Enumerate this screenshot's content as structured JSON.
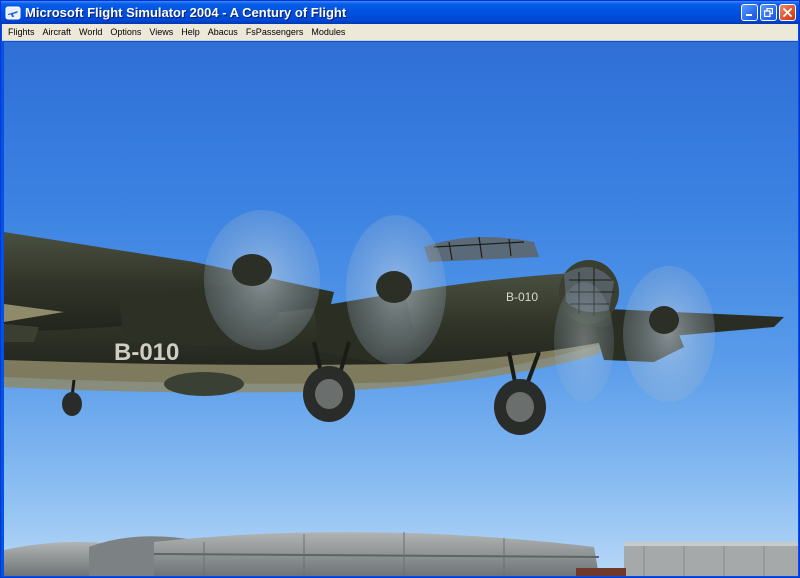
{
  "window": {
    "title": "Microsoft Flight Simulator 2004 - A Century of Flight",
    "icon": "flight-simulator-app-icon"
  },
  "caption_buttons": [
    {
      "name": "minimize-button",
      "icon": "minimize-icon"
    },
    {
      "name": "restore-button",
      "icon": "restore-icon"
    },
    {
      "name": "close-button",
      "icon": "close-icon"
    }
  ],
  "menu": {
    "items": [
      {
        "label": "Flights"
      },
      {
        "label": "Aircraft"
      },
      {
        "label": "World"
      },
      {
        "label": "Options"
      },
      {
        "label": "Views"
      },
      {
        "label": "Help"
      },
      {
        "label": "Abacus"
      },
      {
        "label": "FsPassengers"
      },
      {
        "label": "Modules"
      }
    ]
  },
  "scene": {
    "aircraft_registration": "B-010",
    "fuselage_code": "B-010",
    "colors": {
      "sky_top": "#2f6fd6",
      "sky_bottom": "#b8d8f6",
      "aircraft": "#2f3327",
      "aircraft_underside": "#8e8a6a",
      "hangar": "#8f9496"
    }
  }
}
